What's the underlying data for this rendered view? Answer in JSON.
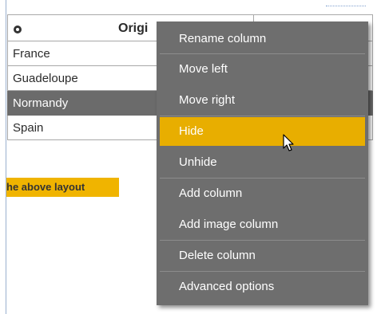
{
  "table": {
    "header_title": "Origi",
    "rows": [
      {
        "label": "France",
        "selected": false
      },
      {
        "label": "Guadeloupe",
        "selected": false
      },
      {
        "label": "Normandy",
        "selected": true
      },
      {
        "label": "Spain",
        "selected": false
      }
    ],
    "note_text": "he above layout"
  },
  "context_menu": {
    "items": [
      {
        "label": "Rename column"
      },
      {
        "label": "Move left"
      },
      {
        "label": "Move right"
      },
      {
        "label": "Hide",
        "active": true
      },
      {
        "label": "Unhide"
      },
      {
        "label": "Add column"
      },
      {
        "label": "Add image column"
      },
      {
        "label": "Delete column"
      },
      {
        "label": "Advanced options"
      }
    ]
  },
  "colors": {
    "menu_background": "#6e6e6e",
    "menu_highlight": "#e8ae00",
    "selected_row": "#6b6b6b",
    "note_highlight": "#f0b400"
  },
  "icons": {
    "header": "eye-icon",
    "pointer": "mouse-cursor-icon"
  }
}
